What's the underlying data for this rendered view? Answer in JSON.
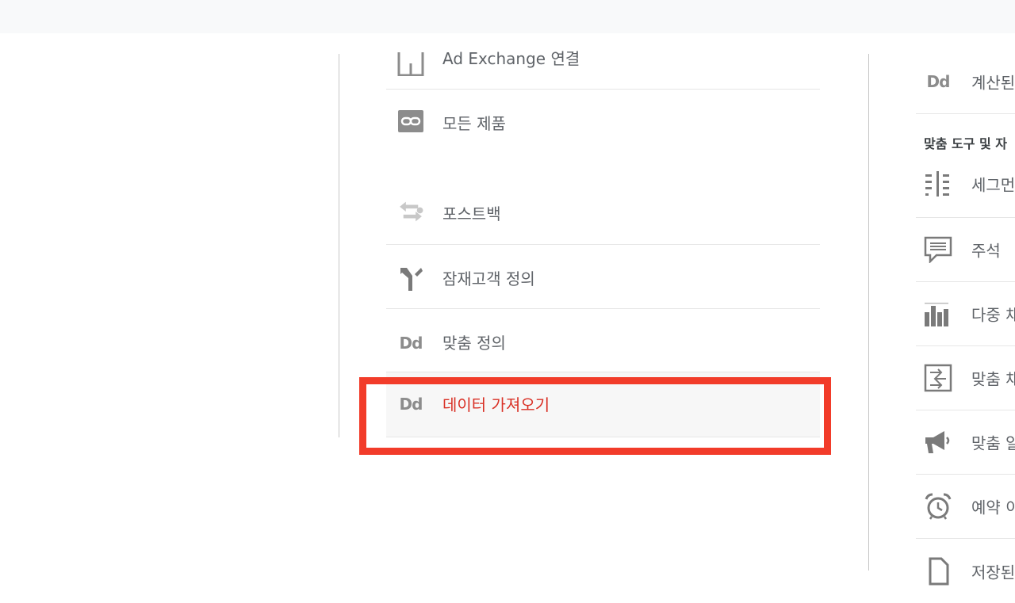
{
  "property_column": {
    "items": [
      {
        "label": "Ad Exchange 연결",
        "icon": "ad-exchange-icon"
      },
      {
        "label": "모든 제품",
        "icon": "link-icon"
      },
      {
        "label": "포스트백",
        "icon": "postback-icon"
      },
      {
        "label": "잠재고객 정의",
        "icon": "audience-fork-icon"
      },
      {
        "label": "맞춤 정의",
        "icon": "dd-icon",
        "icon_text": "Dd"
      },
      {
        "label": "데이터 가져오기",
        "icon": "dd-icon",
        "icon_text": "Dd",
        "selected": true
      }
    ]
  },
  "view_column": {
    "top_item": {
      "label": "계산된",
      "icon": "dd-icon",
      "icon_text": "Dd"
    },
    "section_title": "맞춤 도구 및 자",
    "items": [
      {
        "label": "세그먼",
        "icon": "segments-icon"
      },
      {
        "label": "주석",
        "icon": "annotation-icon"
      },
      {
        "label": "다중 채",
        "icon": "multi-channel-icon"
      },
      {
        "label": "맞춤 채",
        "icon": "custom-channel-icon"
      },
      {
        "label": "맞춤 알",
        "icon": "megaphone-icon"
      },
      {
        "label": "예약 이",
        "icon": "alarm-clock-icon"
      },
      {
        "label": "저장된",
        "icon": "document-icon"
      }
    ]
  },
  "colors": {
    "selected_text": "#d93025",
    "highlight_border": "#f23c2a",
    "icon_gray": "#8c8c8c"
  }
}
